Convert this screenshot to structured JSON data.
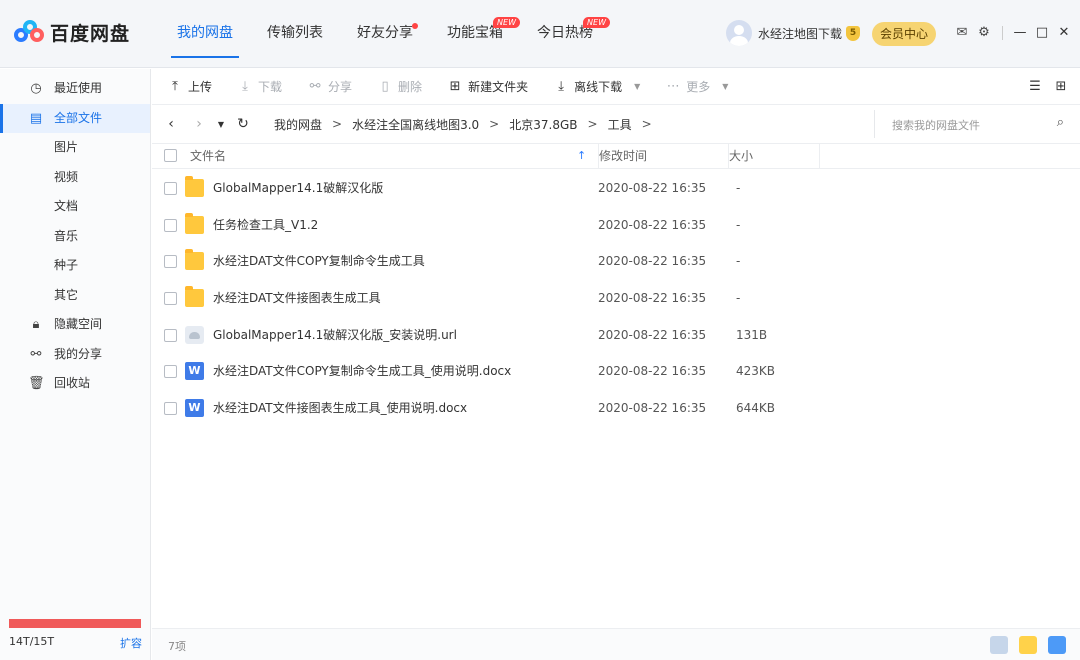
{
  "app": {
    "logo_text": "百度网盘"
  },
  "nav_tabs": [
    {
      "label": "我的网盘",
      "active": true
    },
    {
      "label": "传输列表"
    },
    {
      "label": "好友分享",
      "dot": true
    },
    {
      "label": "功能宝箱",
      "badge": "NEW"
    },
    {
      "label": "今日热榜",
      "badge": "NEW"
    }
  ],
  "user": {
    "name": "水经注地图下载",
    "vip_level": "5",
    "member_button": "会员中心"
  },
  "sidebar": {
    "items": [
      {
        "label": "最近使用",
        "icon": "clock-icon"
      },
      {
        "label": "全部文件",
        "icon": "file-icon",
        "active": true
      },
      {
        "label": "图片"
      },
      {
        "label": "视频"
      },
      {
        "label": "文档"
      },
      {
        "label": "音乐"
      },
      {
        "label": "种子"
      },
      {
        "label": "其它"
      },
      {
        "label": "隐藏空间",
        "icon": "lock-icon"
      },
      {
        "label": "我的分享",
        "icon": "share-icon"
      },
      {
        "label": "回收站",
        "icon": "trash-icon"
      }
    ],
    "quota": "14T/15T",
    "quota_used_fraction": 0.933,
    "expand": "扩容"
  },
  "toolbar": {
    "upload": "上传",
    "download": "下载",
    "share": "分享",
    "delete": "删除",
    "new_folder": "新建文件夹",
    "offline_download": "离线下载",
    "more": "更多"
  },
  "breadcrumb": [
    "我的网盘",
    "水经注全国离线地图3.0",
    "北京37.8GB",
    "工具"
  ],
  "search": {
    "placeholder": "搜索我的网盘文件"
  },
  "columns": {
    "name": "文件名",
    "time": "修改时间",
    "size": "大小"
  },
  "files": [
    {
      "name": "GlobalMapper14.1破解汉化版",
      "type": "folder",
      "time": "2020-08-22 16:35",
      "size": "-"
    },
    {
      "name": "任务检查工具_V1.2",
      "type": "folder",
      "time": "2020-08-22 16:35",
      "size": "-"
    },
    {
      "name": "水经注DAT文件COPY复制命令生成工具",
      "type": "folder",
      "time": "2020-08-22 16:35",
      "size": "-"
    },
    {
      "name": "水经注DAT文件接图表生成工具",
      "type": "folder",
      "time": "2020-08-22 16:35",
      "size": "-"
    },
    {
      "name": "GlobalMapper14.1破解汉化版_安装说明.url",
      "type": "url",
      "time": "2020-08-22 16:35",
      "size": "131B"
    },
    {
      "name": "水经注DAT文件COPY复制命令生成工具_使用说明.docx",
      "type": "docx",
      "time": "2020-08-22 16:35",
      "size": "423KB"
    },
    {
      "name": "水经注DAT文件接图表生成工具_使用说明.docx",
      "type": "docx",
      "time": "2020-08-22 16:35",
      "size": "644KB"
    }
  ],
  "status": {
    "count": "7项"
  },
  "colors": {
    "accent": "#1a73e8",
    "quota_bar": "#f05a5a",
    "member": "#f6d472"
  }
}
